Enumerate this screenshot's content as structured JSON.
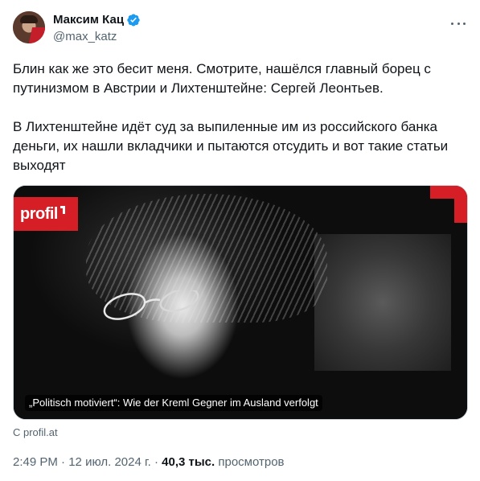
{
  "author": {
    "name": "Максим Кац",
    "handle": "@max_katz",
    "verified": true,
    "verified_color": "#1d9bf0"
  },
  "tweet": {
    "paragraphs": [
      "Блин как же это бесит меня. Смотрите, нашёлся главный борец с путинизмом в Австрии и Лихтенштейне: Сергей Леонтьев.",
      "В Лихтенштейне идёт суд за выпиленные им из российского банка деньги, их нашли вкладчики и пытаются отсудить и вот такие статьи выходят"
    ]
  },
  "card": {
    "logo_text": "profil",
    "logo_color": "#d51e26",
    "caption": "„Politisch motiviert“: Wie der Kreml Gegner im Ausland verfolgt",
    "source": "С profil.at"
  },
  "meta": {
    "time": "2:49 PM",
    "separator": "·",
    "date": "12 июл. 2024 г.",
    "views_count": "40,3 тыс.",
    "views_label": "просмотров"
  },
  "icons": {
    "more": "more-dots-icon",
    "verified": "verified-badge-icon"
  }
}
